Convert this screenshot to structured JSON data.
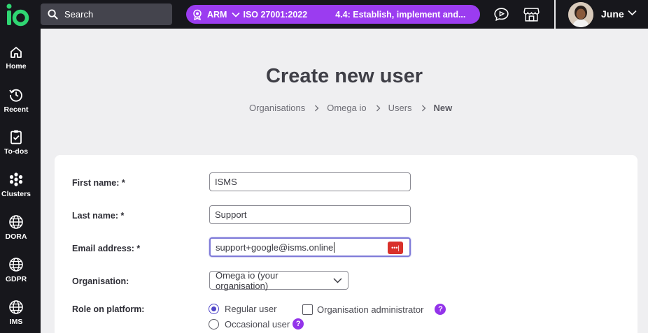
{
  "app": {
    "logo_icon": "io-logo-icon"
  },
  "topbar": {
    "search_label": "Search",
    "context": {
      "standard_icon": "badge-icon",
      "short": "ARM",
      "standard": "ISO 27001:2022",
      "requirement": "4.4: Establish, implement and..."
    },
    "icons": [
      "video-chat-icon",
      "store-icon"
    ],
    "user": {
      "name": "June"
    }
  },
  "sidebar": {
    "items": [
      {
        "label": "Home",
        "icon": "home-icon"
      },
      {
        "label": "Recent",
        "icon": "history-icon"
      },
      {
        "label": "To-dos",
        "icon": "clipboard-check-icon"
      },
      {
        "label": "Clusters",
        "icon": "clusters-icon"
      },
      {
        "label": "DORA",
        "icon": "globe-icon"
      },
      {
        "label": "GDPR",
        "icon": "globe-icon"
      },
      {
        "label": "IMS",
        "icon": "globe-icon"
      }
    ]
  },
  "main": {
    "title": "Create new user",
    "breadcrumb": [
      "Organisations",
      "Omega io",
      "Users",
      "New"
    ]
  },
  "form": {
    "first_name": {
      "label": "First name: *",
      "value": "ISMS"
    },
    "last_name": {
      "label": "Last name: *",
      "value": "Support"
    },
    "email": {
      "label": "Email address: *",
      "value": "support+google@isms.online"
    },
    "organisation": {
      "label": "Organisation:",
      "value": "Omega io (your organisation)"
    },
    "role": {
      "label": "Role on platform:",
      "options": [
        {
          "label": "Regular user",
          "selected": true
        },
        {
          "label": "Occasional user",
          "selected": false
        }
      ],
      "admin_checkbox": {
        "label": "Organisation administrator",
        "checked": false
      },
      "help": "?"
    }
  },
  "colors": {
    "accent": "#9b3cf0",
    "topbar": "#17171c",
    "logo": "#2fd672",
    "radio": "#4f46c8"
  }
}
